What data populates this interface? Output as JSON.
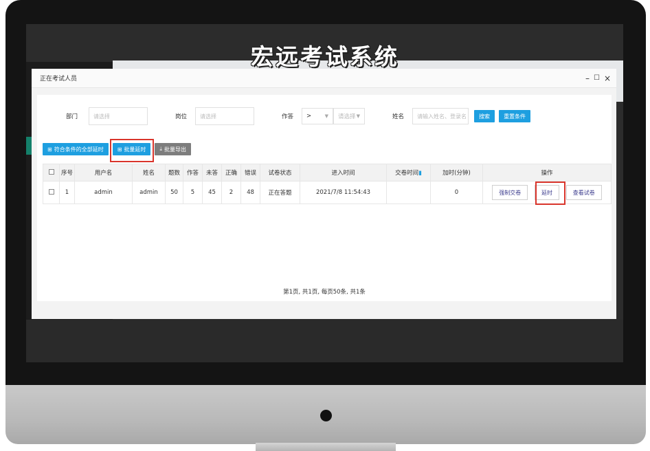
{
  "app_title": "宏远考试系统",
  "modal": {
    "title": "正在考试人员",
    "controls": {
      "minimize": "–",
      "maximize": "☐",
      "close": "×"
    }
  },
  "filters": {
    "department_label": "部门",
    "department_placeholder": "请选择",
    "position_label": "岗位",
    "position_placeholder": "请选择",
    "answered_label": "作答",
    "operator_value": ">",
    "answered_select_placeholder": "请选择",
    "name_label": "姓名",
    "name_placeholder": "请输入姓名、登录名",
    "search_label": "搜索",
    "reset_label": "重置条件"
  },
  "toolbar": {
    "extend_all_label": "符合条件的全部延时",
    "batch_extend_label": "批量延时",
    "batch_export_label": "批量导出"
  },
  "table": {
    "headers": [
      "",
      "序号",
      "用户名",
      "姓名",
      "题数",
      "作答",
      "未答",
      "正确",
      "错误",
      "试卷状态",
      "进入时间",
      "交卷时间",
      "加时(分钟)",
      "操作"
    ],
    "rows": [
      {
        "index": "1",
        "username": "admin",
        "name": "admin",
        "questions": "50",
        "answered": "5",
        "unanswered": "45",
        "correct": "2",
        "wrong": "48",
        "status": "正在答题",
        "entry_time": "2021/7/8 11:54:43",
        "submit_time": "",
        "extra_minutes": "0",
        "actions": {
          "force_submit": "强制交卷",
          "extend": "延时",
          "view_paper": "查看试卷"
        }
      }
    ]
  },
  "pagination": "第1页, 共1页, 每页50条, 共1条",
  "colors": {
    "primary_blue": "#1e9fe0",
    "highlight_red": "#d9342b",
    "gray_button": "#7d7d7d"
  }
}
